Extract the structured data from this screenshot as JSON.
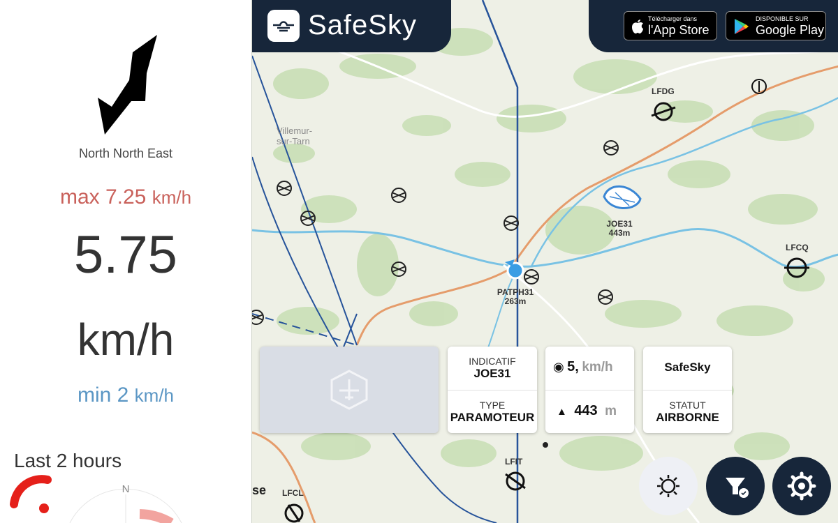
{
  "wind": {
    "direction": "North North East",
    "max_label": "max 7.25",
    "max_unit": "km/h",
    "speed": "5.75",
    "speed_unit": "km/h",
    "min_label": "min 2",
    "min_unit": "km/h",
    "history_title": "Last 2 hours",
    "compass_north": "N"
  },
  "header": {
    "brand": "SafeSky",
    "appstore_small": "Télécharger dans",
    "appstore_big": "l'App Store",
    "googleplay_small": "DISPONIBLE SUR",
    "googleplay_big": "Google Play"
  },
  "map": {
    "towns": [
      "Villemur-",
      "sur-Tarn",
      "se"
    ],
    "airfields": [
      "LFDG",
      "LFCQ",
      "LFIT",
      "LFCL"
    ],
    "aircraft": [
      {
        "callsign": "JOE31",
        "altitude": "443m"
      },
      {
        "callsign": "PATPH31",
        "altitude": "263m"
      }
    ]
  },
  "info": {
    "callsign_key": "INDICATIF",
    "callsign_value": "JOE31",
    "type_key": "TYPE",
    "type_value": "PARAMOTEUR",
    "speed_value": "5,",
    "speed_unit": "km/h",
    "altitude_value": "443",
    "altitude_unit": "m",
    "source_value": "SafeSky",
    "status_key": "STATUT",
    "status_value": "AIRBORNE"
  },
  "colors": {
    "navy": "#17263a",
    "max_red": "#c9615b",
    "min_blue": "#5a96c4",
    "gust_red": "#e5201a",
    "airspace_blue": "#26539a",
    "road_orange": "#e59c6b",
    "river_blue": "#79c2e4"
  }
}
